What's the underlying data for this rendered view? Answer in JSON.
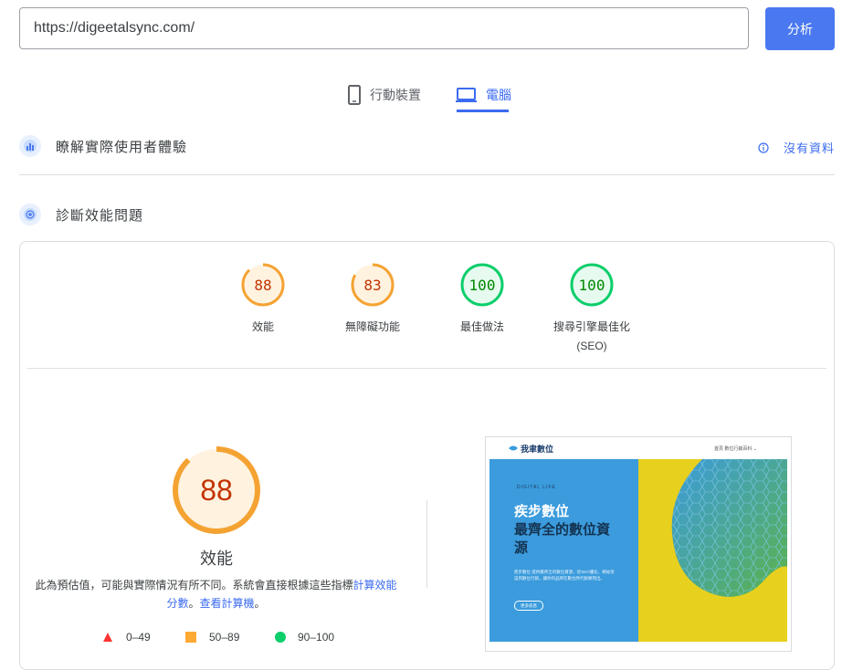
{
  "url_bar": {
    "value": "https://digeetalsync.com/"
  },
  "analyze_button": "分析",
  "tabs": [
    {
      "label": "行動裝置",
      "icon": "smartphone-icon",
      "active": false
    },
    {
      "label": "電腦",
      "icon": "laptop-icon",
      "active": true
    }
  ],
  "real_user": {
    "title": "瞭解實際使用者體驗",
    "status": "沒有資料",
    "icon": "users-icon"
  },
  "diagnostics": {
    "title": "診斷效能問題",
    "icon": "lab-icon"
  },
  "scores": [
    {
      "value": 88,
      "label": "效能",
      "color": "#f4a333",
      "text_color": "#c33300"
    },
    {
      "value": 83,
      "label": "無障礙功能",
      "color": "#f4a333",
      "text_color": "#c33300"
    },
    {
      "value": 100,
      "label": "最佳做法",
      "color": "#0cce6b",
      "text_color": "#008800"
    },
    {
      "value": 100,
      "label": "搜尋引擎最佳化",
      "label2": "(SEO)",
      "color": "#0cce6b",
      "text_color": "#008800"
    }
  ],
  "performance": {
    "score": 88,
    "label": "效能",
    "description_prefix": "此為預估值，可能與實際情況有所不同。系統會直接根據這些指標",
    "link1": "計算效能分數",
    "sep": "。",
    "link2": "查看計算機",
    "suffix": "。"
  },
  "legend": [
    {
      "range": "0–49",
      "shape": "triangle",
      "color": "#ff3333"
    },
    {
      "range": "50–89",
      "shape": "square",
      "color": "#ffaa33"
    },
    {
      "range": "90–100",
      "shape": "circle",
      "color": "#0cce6b"
    }
  ],
  "screenshot": {
    "logo": "我聿數位",
    "nav": "首頁  數位行銷百科 ⌄",
    "kicker": "DIGITAL LIFE",
    "heading1": "疾步數位",
    "heading2": "最齊全的數位資",
    "heading3": "源",
    "body": "疾步數位 提供最齊全的數位資源，從SEO優化、網站架設到數位行銷，讓你的品牌在數位時代脫穎而出。",
    "button": "更多訊息"
  }
}
